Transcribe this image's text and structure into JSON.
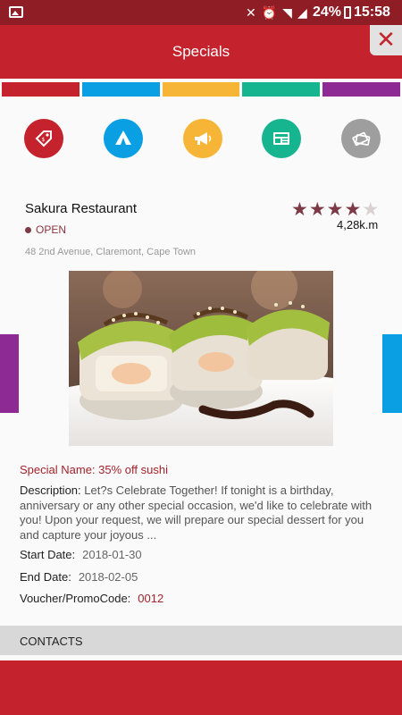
{
  "status_bar": {
    "battery": "24%",
    "time": "15:58",
    "icons": [
      "image-icon",
      "mute-icon",
      "alarm-icon",
      "wifi-icon",
      "signal-icon",
      "battery-icon"
    ]
  },
  "appbar": {
    "title": "Specials",
    "close_glyph": "✕"
  },
  "color_strip": [
    "#c4222c",
    "#0a9ee2",
    "#f7b538",
    "#17b58f",
    "#8e2a93"
  ],
  "categories": [
    {
      "icon": "price-tag-icon",
      "color": "#c4222c"
    },
    {
      "icon": "tent-icon",
      "color": "#0a9ee2"
    },
    {
      "icon": "megaphone-icon",
      "color": "#f7b538"
    },
    {
      "icon": "newspaper-icon",
      "color": "#17b58f"
    },
    {
      "icon": "tickets-icon",
      "color": "#9e9e9e"
    }
  ],
  "restaurant": {
    "name": "Sakura Restaurant",
    "rating": 4,
    "rating_max": 5,
    "distance": "4,28k.m",
    "status": "OPEN",
    "address": "48 2nd Avenue, Claremont, Cape Town"
  },
  "special": {
    "name": "Special Name: 35% off sushi",
    "description_label": "Description:",
    "description": "Let?s Celebrate Together! If tonight is a birthday, anniversary or any other special occasion, we'd like to celebrate with you! Upon your request, we will prepare our special dessert for you and capture your joyous ...",
    "start_label": "Start Date:",
    "start_date": "2018-01-30",
    "end_label": "End Date:",
    "end_date": "2018-02-05",
    "promo_label": "Voucher/PromoCode:",
    "promo_code": "0012"
  },
  "contacts": {
    "label": "CONTACTS"
  }
}
